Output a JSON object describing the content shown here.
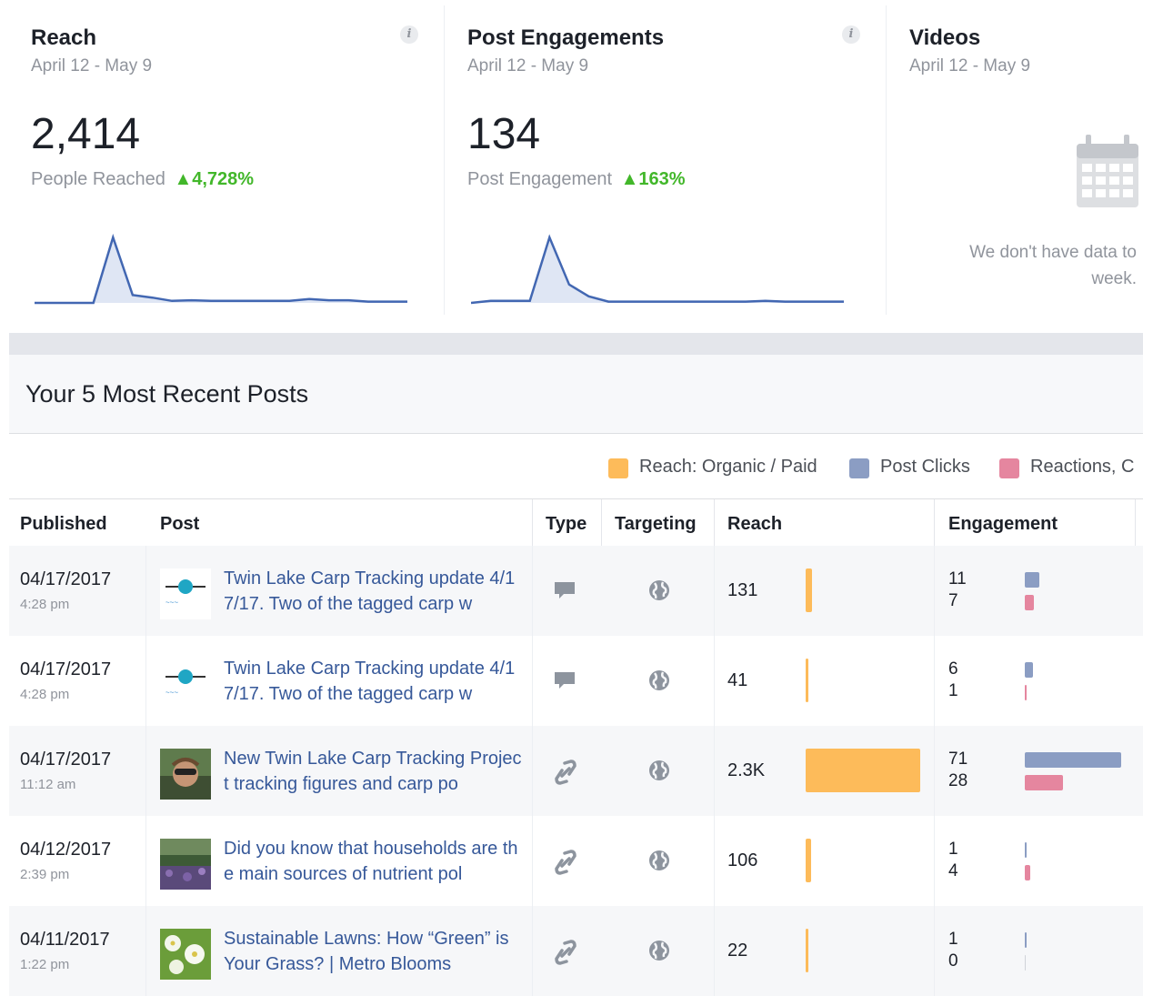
{
  "cards": [
    {
      "title": "Reach",
      "date": "April 12 - May 9",
      "value": "2,414",
      "label": "People Reached",
      "delta": "4,728%",
      "info": "i",
      "spark": [
        0,
        0,
        0,
        0,
        1.0,
        0.12,
        0.08,
        0.03,
        0.04,
        0.03,
        0.03,
        0.03,
        0.03,
        0.03,
        0.06,
        0.04,
        0.04,
        0.02,
        0.02,
        0.02
      ]
    },
    {
      "title": "Post Engagements",
      "date": "April 12 - May 9",
      "value": "134",
      "label": "Post Engagement",
      "delta": "163%",
      "info": "i",
      "spark": [
        0,
        0.03,
        0.03,
        0.03,
        1.0,
        0.28,
        0.1,
        0.02,
        0.02,
        0.02,
        0.02,
        0.02,
        0.02,
        0.02,
        0.02,
        0.03,
        0.02,
        0.02,
        0.02,
        0.02
      ]
    },
    {
      "title": "Videos",
      "date": "April 12 - May 9",
      "nodata": "We don't have data to week."
    }
  ],
  "section_title": "Your 5 Most Recent Posts",
  "legend": {
    "reach": "Reach: Organic / Paid",
    "clicks": "Post Clicks",
    "reactions": "Reactions, C"
  },
  "colors": {
    "reach": "#fdbb5a",
    "clicks": "#8b9dc3",
    "reactions": "#e5869f",
    "delta": "#42b72a",
    "link": "#365899",
    "spark": "#4267b2"
  },
  "columns": {
    "published": "Published",
    "post": "Post",
    "type": "Type",
    "targeting": "Targeting",
    "reach": "Reach",
    "engagement": "Engagement"
  },
  "posts": [
    {
      "date": "04/17/2017",
      "time": "4:28 pm",
      "text": "Twin Lake Carp Tracking update 4/17/17. Two of the tagged carp w",
      "type": "status-icon",
      "reach": "131",
      "reach_value": 131,
      "clicks": "11",
      "reactions": "7",
      "clicks_value": 11,
      "reactions_value": 7,
      "thumb": "logo"
    },
    {
      "date": "04/17/2017",
      "time": "4:28 pm",
      "text": "Twin Lake Carp Tracking update 4/17/17. Two of the tagged carp w",
      "type": "status-icon",
      "reach": "41",
      "reach_value": 41,
      "clicks": "6",
      "reactions": "1",
      "clicks_value": 6,
      "reactions_value": 1,
      "thumb": "logo"
    },
    {
      "date": "04/17/2017",
      "time": "11:12 am",
      "text": "New Twin Lake Carp Tracking Project tracking figures and carp po",
      "type": "link-icon",
      "reach": "2.3K",
      "reach_value": 2300,
      "clicks": "71",
      "reactions": "28",
      "clicks_value": 71,
      "reactions_value": 28,
      "thumb": "person"
    },
    {
      "date": "04/12/2017",
      "time": "2:39 pm",
      "text": "Did you know that households are the main sources of nutrient pol",
      "type": "link-icon",
      "reach": "106",
      "reach_value": 106,
      "clicks": "1",
      "reactions": "4",
      "clicks_value": 1,
      "reactions_value": 4,
      "thumb": "garden"
    },
    {
      "date": "04/11/2017",
      "time": "1:22 pm",
      "text": "Sustainable Lawns: How “Green” is Your Grass? | Metro Blooms",
      "type": "link-icon",
      "reach": "22",
      "reach_value": 22,
      "clicks": "1",
      "reactions": "0",
      "clicks_value": 1,
      "reactions_value": 0,
      "thumb": "flowers"
    }
  ]
}
